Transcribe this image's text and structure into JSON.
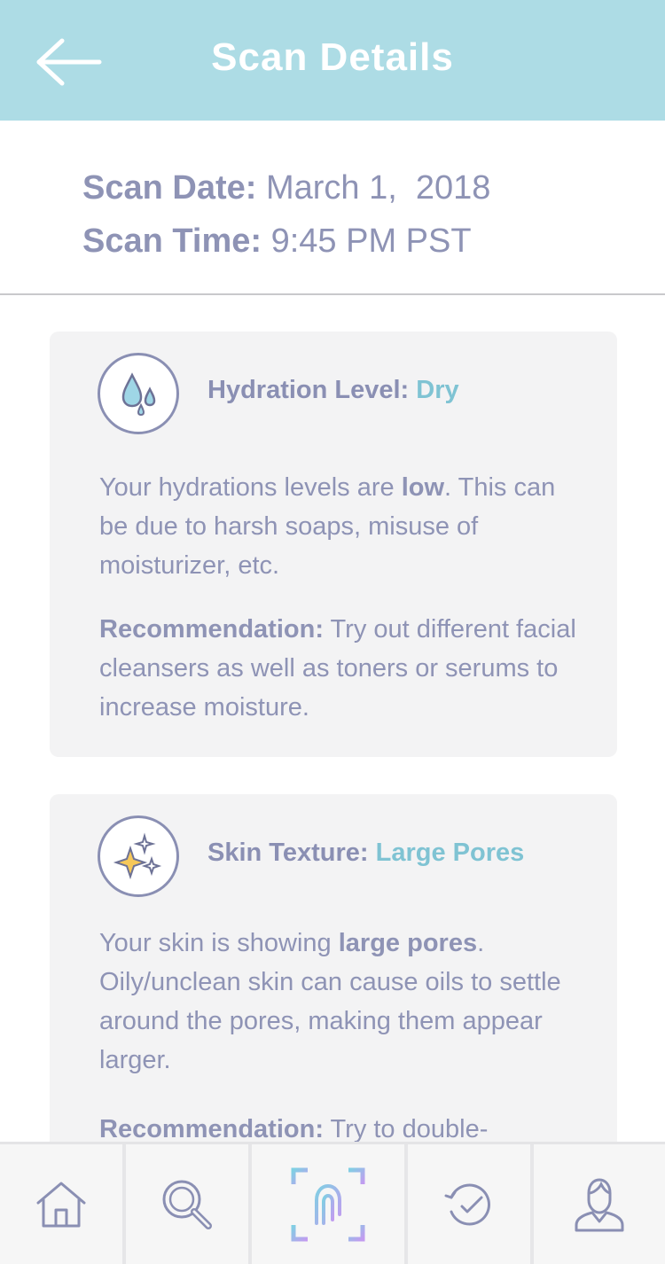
{
  "header": {
    "title": "Scan Details",
    "back_icon": "arrow-left-icon"
  },
  "scan": {
    "date_label": "Scan Date:",
    "date_value": "March 1,  2018",
    "time_label": "Scan Time:",
    "time_value": "9:45 PM PST"
  },
  "cards": [
    {
      "icon": "water-drops-icon",
      "label": "Hydration Level:",
      "value": "Dry",
      "desc_before": "Your hydrations levels are ",
      "desc_bold": "low",
      "desc_after": ". This can be due to harsh soaps, misuse of moisturizer, etc.",
      "rec_label": "Recommendation:",
      "rec_text": " Try out different facial cleansers as well as toners or serums to increase moisture."
    },
    {
      "icon": "sparkles-icon",
      "label": "Skin Texture:",
      "value": "Large Pores",
      "desc_before": "Your skin is showing ",
      "desc_bold": "large pores",
      "desc_after": ". Oily/unclean skin can cause oils to settle around the pores, making them appear larger.",
      "rec_label": "Recommendation:",
      "rec_text": " Try to double-"
    }
  ],
  "tabbar": {
    "tabs": [
      "home-icon",
      "search-icon",
      "face-scan-icon",
      "history-icon",
      "profile-icon"
    ]
  },
  "colors": {
    "header_bg": "#addce5",
    "accent_value": "#7fc3d3",
    "text": "#8a8fb3",
    "card_bg": "#f3f3f4",
    "scan_gradient_start": "#7fd0e3",
    "scan_gradient_end": "#c39bf0"
  }
}
